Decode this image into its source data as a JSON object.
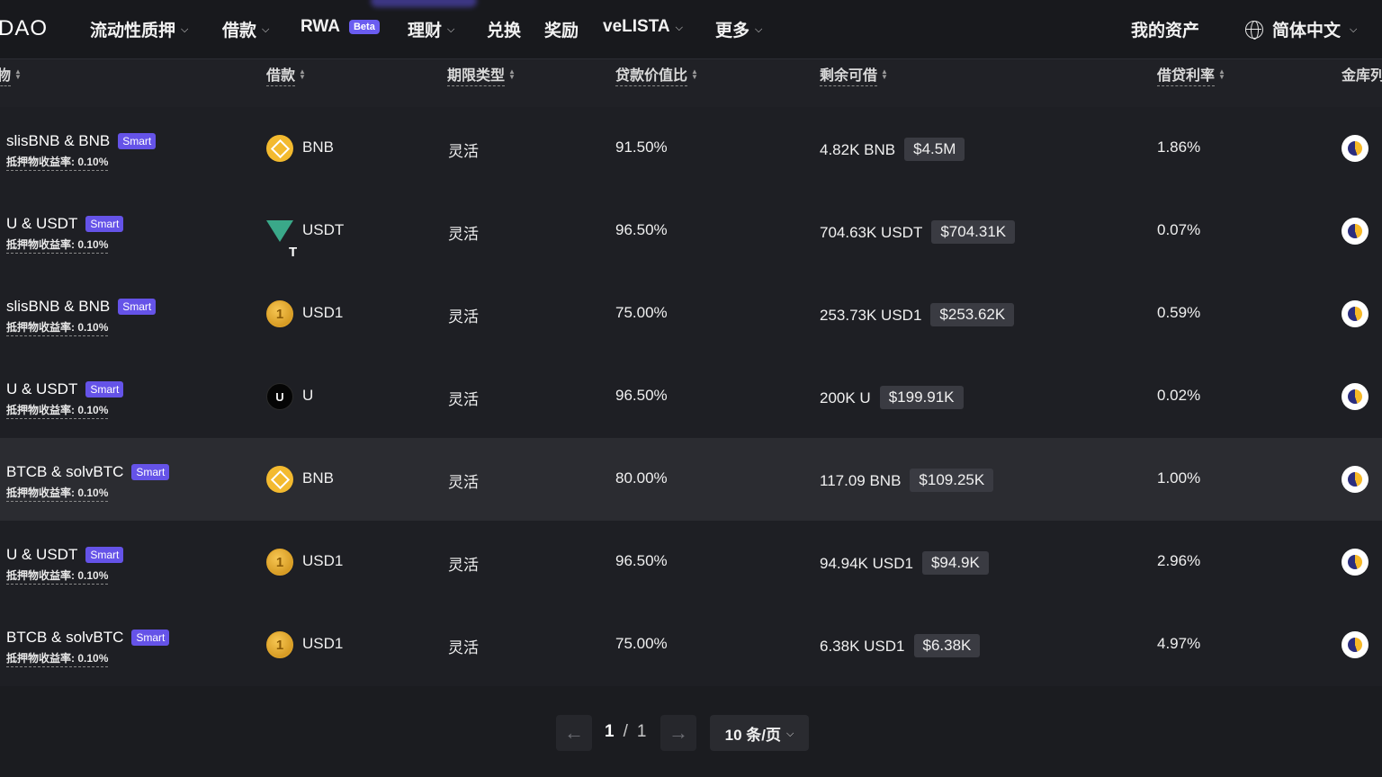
{
  "nav": {
    "logo": "DAO",
    "items": [
      {
        "label": "流动性质押",
        "dropdown": true
      },
      {
        "label": "借款",
        "dropdown": true
      },
      {
        "label": "RWA",
        "badge": "Beta"
      },
      {
        "label": "理财",
        "dropdown": true
      },
      {
        "label": "兑换"
      },
      {
        "label": "奖励"
      },
      {
        "label": "veLISTA",
        "dropdown": true
      },
      {
        "label": "更多",
        "dropdown": true
      }
    ],
    "my_assets": "我的资产",
    "language": "简体中文"
  },
  "table": {
    "headers": [
      "物",
      "借款",
      "期限类型",
      "贷款价值比",
      "剩余可借",
      "借贷利率",
      "金库列"
    ],
    "yield_label": "抵押物收益率:",
    "rows": [
      {
        "collateral": "slisBNB & BNB",
        "tag": "Smart",
        "yield": "0.10%",
        "asset": "BNB",
        "asset_icon": "bnb-icon",
        "term": "灵活",
        "ltv": "91.50%",
        "remaining": "4.82K BNB",
        "remaining_usd": "$4.5M",
        "rate": "1.86%"
      },
      {
        "collateral": "U & USDT",
        "tag": "Smart",
        "yield": "0.10%",
        "asset": "USDT",
        "asset_icon": "usdt-icon",
        "term": "灵活",
        "ltv": "96.50%",
        "remaining": "704.63K USDT",
        "remaining_usd": "$704.31K",
        "rate": "0.07%"
      },
      {
        "collateral": "slisBNB & BNB",
        "tag": "Smart",
        "yield": "0.10%",
        "asset": "USD1",
        "asset_icon": "usd1-icon",
        "term": "灵活",
        "ltv": "75.00%",
        "remaining": "253.73K USD1",
        "remaining_usd": "$253.62K",
        "rate": "0.59%"
      },
      {
        "collateral": "U & USDT",
        "tag": "Smart",
        "yield": "0.10%",
        "asset": "U",
        "asset_icon": "u-icon",
        "term": "灵活",
        "ltv": "96.50%",
        "remaining": "200K U",
        "remaining_usd": "$199.91K",
        "rate": "0.02%"
      },
      {
        "collateral": "BTCB & solvBTC",
        "tag": "Smart",
        "yield": "0.10%",
        "asset": "BNB",
        "asset_icon": "bnb-icon",
        "term": "灵活",
        "ltv": "80.00%",
        "remaining": "117.09 BNB",
        "remaining_usd": "$109.25K",
        "rate": "1.00%",
        "highlighted": true
      },
      {
        "collateral": "U & USDT",
        "tag": "Smart",
        "yield": "0.10%",
        "asset": "USD1",
        "asset_icon": "usd1-icon",
        "term": "灵活",
        "ltv": "96.50%",
        "remaining": "94.94K USD1",
        "remaining_usd": "$94.9K",
        "rate": "2.96%"
      },
      {
        "collateral": "BTCB & solvBTC",
        "tag": "Smart",
        "yield": "0.10%",
        "asset": "USD1",
        "asset_icon": "usd1-icon",
        "term": "灵活",
        "ltv": "75.00%",
        "remaining": "6.38K USD1",
        "remaining_usd": "$6.38K",
        "rate": "4.97%"
      }
    ]
  },
  "pagination": {
    "current": "1",
    "separator": "/",
    "total": "1",
    "page_size": "10 条/页"
  }
}
